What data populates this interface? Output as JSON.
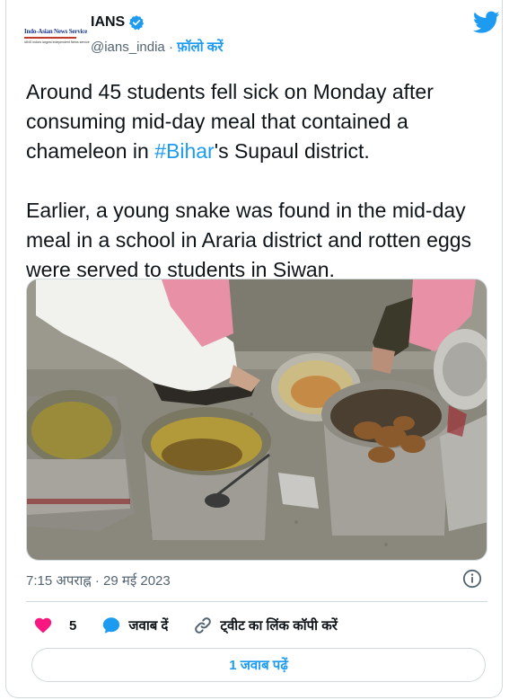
{
  "author": {
    "logo_text_line1": "Indo-Asian News Service",
    "logo_text_line2": "IANS India's largest independent News service",
    "display_name": "IANS",
    "handle": "@ians_india",
    "separator": "·",
    "follow_label": "फ़ॉलो करें",
    "verified": true
  },
  "tweet": {
    "para1_before": "Around 45 students fell sick on Monday after consuming mid-day meal that contained a chameleon in ",
    "hashtag": "#Bihar",
    "para1_after": "'s Supaul district.",
    "para2": "Earlier, a young snake was found in the mid-day meal in a school in Araria district and rotten eggs were served to students in Siwan."
  },
  "timestamp": "7:15 अपराह्न · 29 मई 2023",
  "actions": {
    "like_count": "5",
    "reply_label": "जवाब दें",
    "copy_link_label": "ट्वीट का लिंक कॉपी करें"
  },
  "read_replies_label": "1 जवाब पढ़ें",
  "colors": {
    "accent": "#1d9bf0",
    "like": "#f91880",
    "text": "#0f1419",
    "muted": "#536471",
    "border": "#cfd9de"
  },
  "icons": [
    "verified-badge-icon",
    "twitter-bird-icon",
    "info-icon",
    "heart-icon",
    "reply-bubble-icon",
    "link-icon"
  ]
}
